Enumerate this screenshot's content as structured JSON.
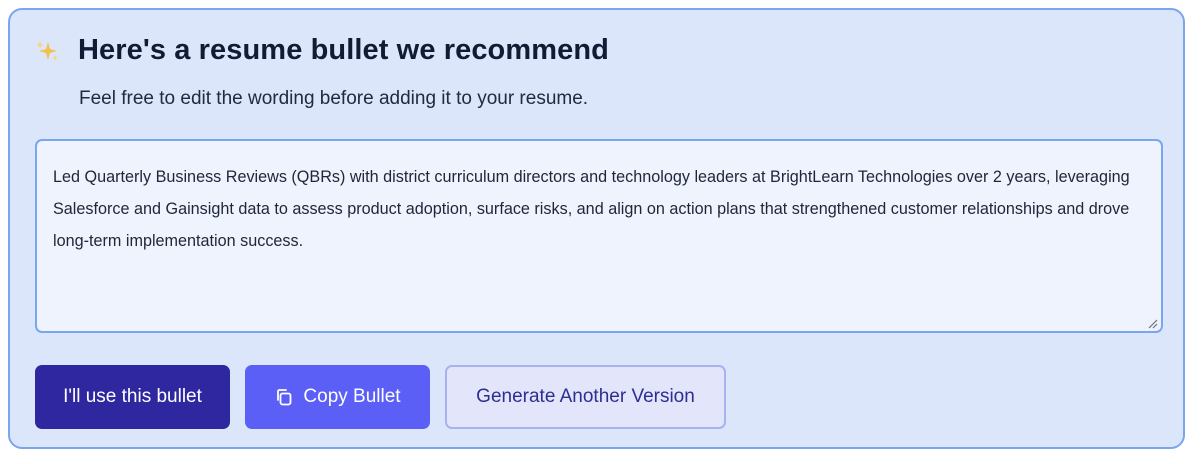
{
  "header": {
    "icon": "sparkles-icon",
    "title": "Here's a resume bullet we recommend",
    "subtitle": "Feel free to edit the wording before adding it to your resume."
  },
  "bullet": {
    "text": "Led Quarterly Business Reviews (QBRs) with district curriculum directors and technology leaders at BrightLearn Technologies over 2 years, leveraging Salesforce and Gainsight data to assess product adoption, surface risks, and align on action plans that strengthened customer relationships and drove long-term implementation success."
  },
  "actions": {
    "use_label": "I'll use this bullet",
    "copy_label": "Copy Bullet",
    "copy_icon": "copy-icon",
    "generate_label": "Generate Another Version"
  },
  "colors": {
    "card_bg": "#dbe6fb",
    "card_border": "#7aa6f0",
    "primary": "#2f27a0",
    "copy": "#5b5ff6",
    "secondary_bg": "#e3e6fb"
  }
}
